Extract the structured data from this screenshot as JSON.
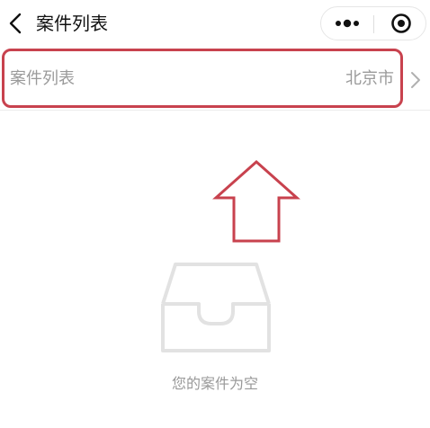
{
  "navbar": {
    "title": "案件列表",
    "back_icon": "chevron-left-icon",
    "more_icon": "more-dots-icon",
    "close_icon": "target-close-icon"
  },
  "city_row": {
    "label": "案件列表",
    "value": "北京市",
    "arrow_icon": "chevron-right-icon",
    "highlight_color": "#c8424e"
  },
  "annotation": {
    "icon": "up-arrow-icon",
    "color": "#c8424e"
  },
  "empty_state": {
    "icon": "empty-inbox-icon",
    "message": "您的案件为空"
  },
  "colors": {
    "title_text": "#111111",
    "muted_text": "#9a9a9a",
    "icon_gray": "#e2e2e2"
  }
}
